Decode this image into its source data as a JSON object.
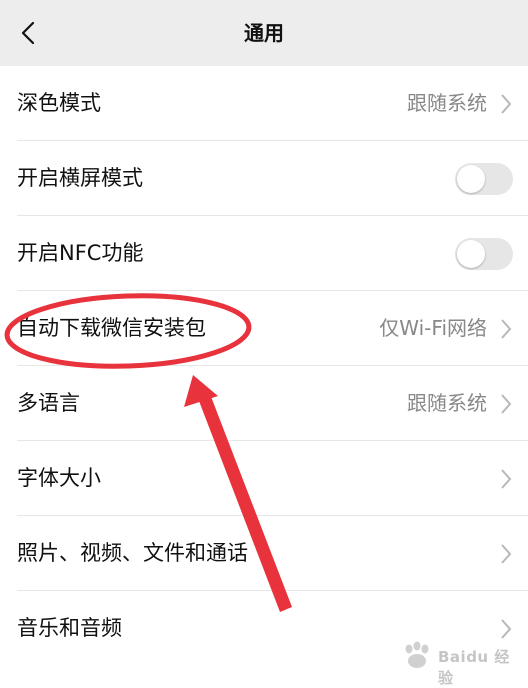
{
  "header": {
    "title": "通用",
    "back_icon": "chevron-left-icon"
  },
  "settings": [
    {
      "label": "深色模式",
      "value": "跟随系统",
      "type": "link"
    },
    {
      "label": "开启横屏模式",
      "type": "toggle",
      "on": false
    },
    {
      "label": "开启NFC功能",
      "type": "toggle",
      "on": false
    },
    {
      "label": "自动下载微信安装包",
      "value": "仅Wi-Fi网络",
      "type": "link"
    },
    {
      "label": "多语言",
      "value": "跟随系统",
      "type": "link"
    },
    {
      "label": "字体大小",
      "type": "link"
    },
    {
      "label": "照片、视频、文件和通话",
      "type": "link"
    },
    {
      "label": "音乐和音频",
      "type": "link"
    }
  ],
  "colors": {
    "header_bg": "#ededed",
    "annotation_red": "#e8323c",
    "toggle_off": "#e6e6e6"
  },
  "watermark": {
    "text": "Baidu 经验"
  }
}
